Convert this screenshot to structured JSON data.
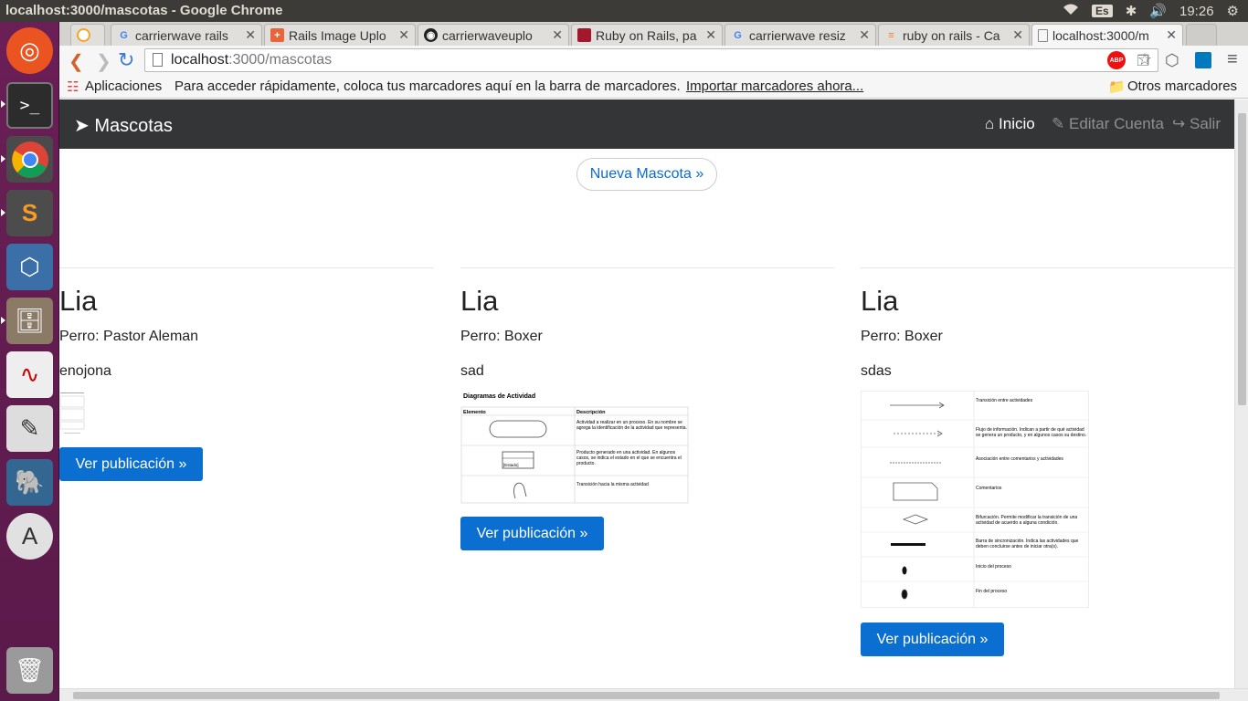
{
  "window": {
    "title": "localhost:3000/mascotas - Google Chrome",
    "keyboard": "Es",
    "time": "19:26"
  },
  "tabs": [
    {
      "label": "carrierwave rails",
      "icon": "google-icon"
    },
    {
      "label": "Rails Image Uplo",
      "icon": "plus-icon"
    },
    {
      "label": "carrierwaveuplo",
      "icon": "github-icon"
    },
    {
      "label": "Ruby on Rails, pa",
      "icon": "ruby-icon"
    },
    {
      "label": "carrierwave resiz",
      "icon": "google-icon"
    },
    {
      "label": "ruby on rails - Ca",
      "icon": "stackoverflow-icon"
    },
    {
      "label": "localhost:3000/m",
      "icon": "page-icon"
    }
  ],
  "address": {
    "host": "localhost",
    "path": ":3000/mascotas"
  },
  "bookmarks": {
    "apps": "Aplicaciones",
    "hint": "Para acceder rápidamente, coloca tus marcadores aquí en la barra de marcadores.",
    "import": "Importar marcadores ahora...",
    "other": "Otros marcadores"
  },
  "navbar": {
    "brand": "Mascotas",
    "home": "Inicio",
    "edit": "Editar Cuenta",
    "logout": "Salir"
  },
  "new_button": "Nueva Mascota »",
  "cards": [
    {
      "name": "Lia",
      "type": "Perro: Pastor Aleman",
      "description": "enojona",
      "button": "Ver publicación »"
    },
    {
      "name": "Lia",
      "type": "Perro: Boxer",
      "description": "sad",
      "button": "Ver publicación »"
    },
    {
      "name": "Lia",
      "type": "Perro: Boxer",
      "description": "sdas",
      "button": "Ver publicación »"
    }
  ],
  "diagram_small": {
    "title": "Diagramas de Actividad",
    "col1": "Elemento",
    "col2": "Descripción",
    "rows": [
      "Actividad a realizar en un proceso. En su nombre se agrega la identificación de la actividad que representa.",
      "Producto generado en una actividad. En algunos casos, se indica el estado en el que se encuentra el producto.",
      "Transición hacia la misma actividad"
    ],
    "state_label": "[Estado]"
  },
  "diagram_large": {
    "rows": [
      "Transición entre actividades",
      "Flujo de información. Indican a partir de qué actividad se genera un producto, y en algunos casos su destino.",
      "Asociación entre comentarios y actividades",
      "Comentarios",
      "Bifurcación. Permite modificar la transición de una actividad de acuerdo a alguna condición.",
      "Barra de sincronización. Indica las actividades que deben concluirse antes de iniciar otra(s).",
      "Inicio del proceso",
      "Fin del proceso"
    ]
  }
}
